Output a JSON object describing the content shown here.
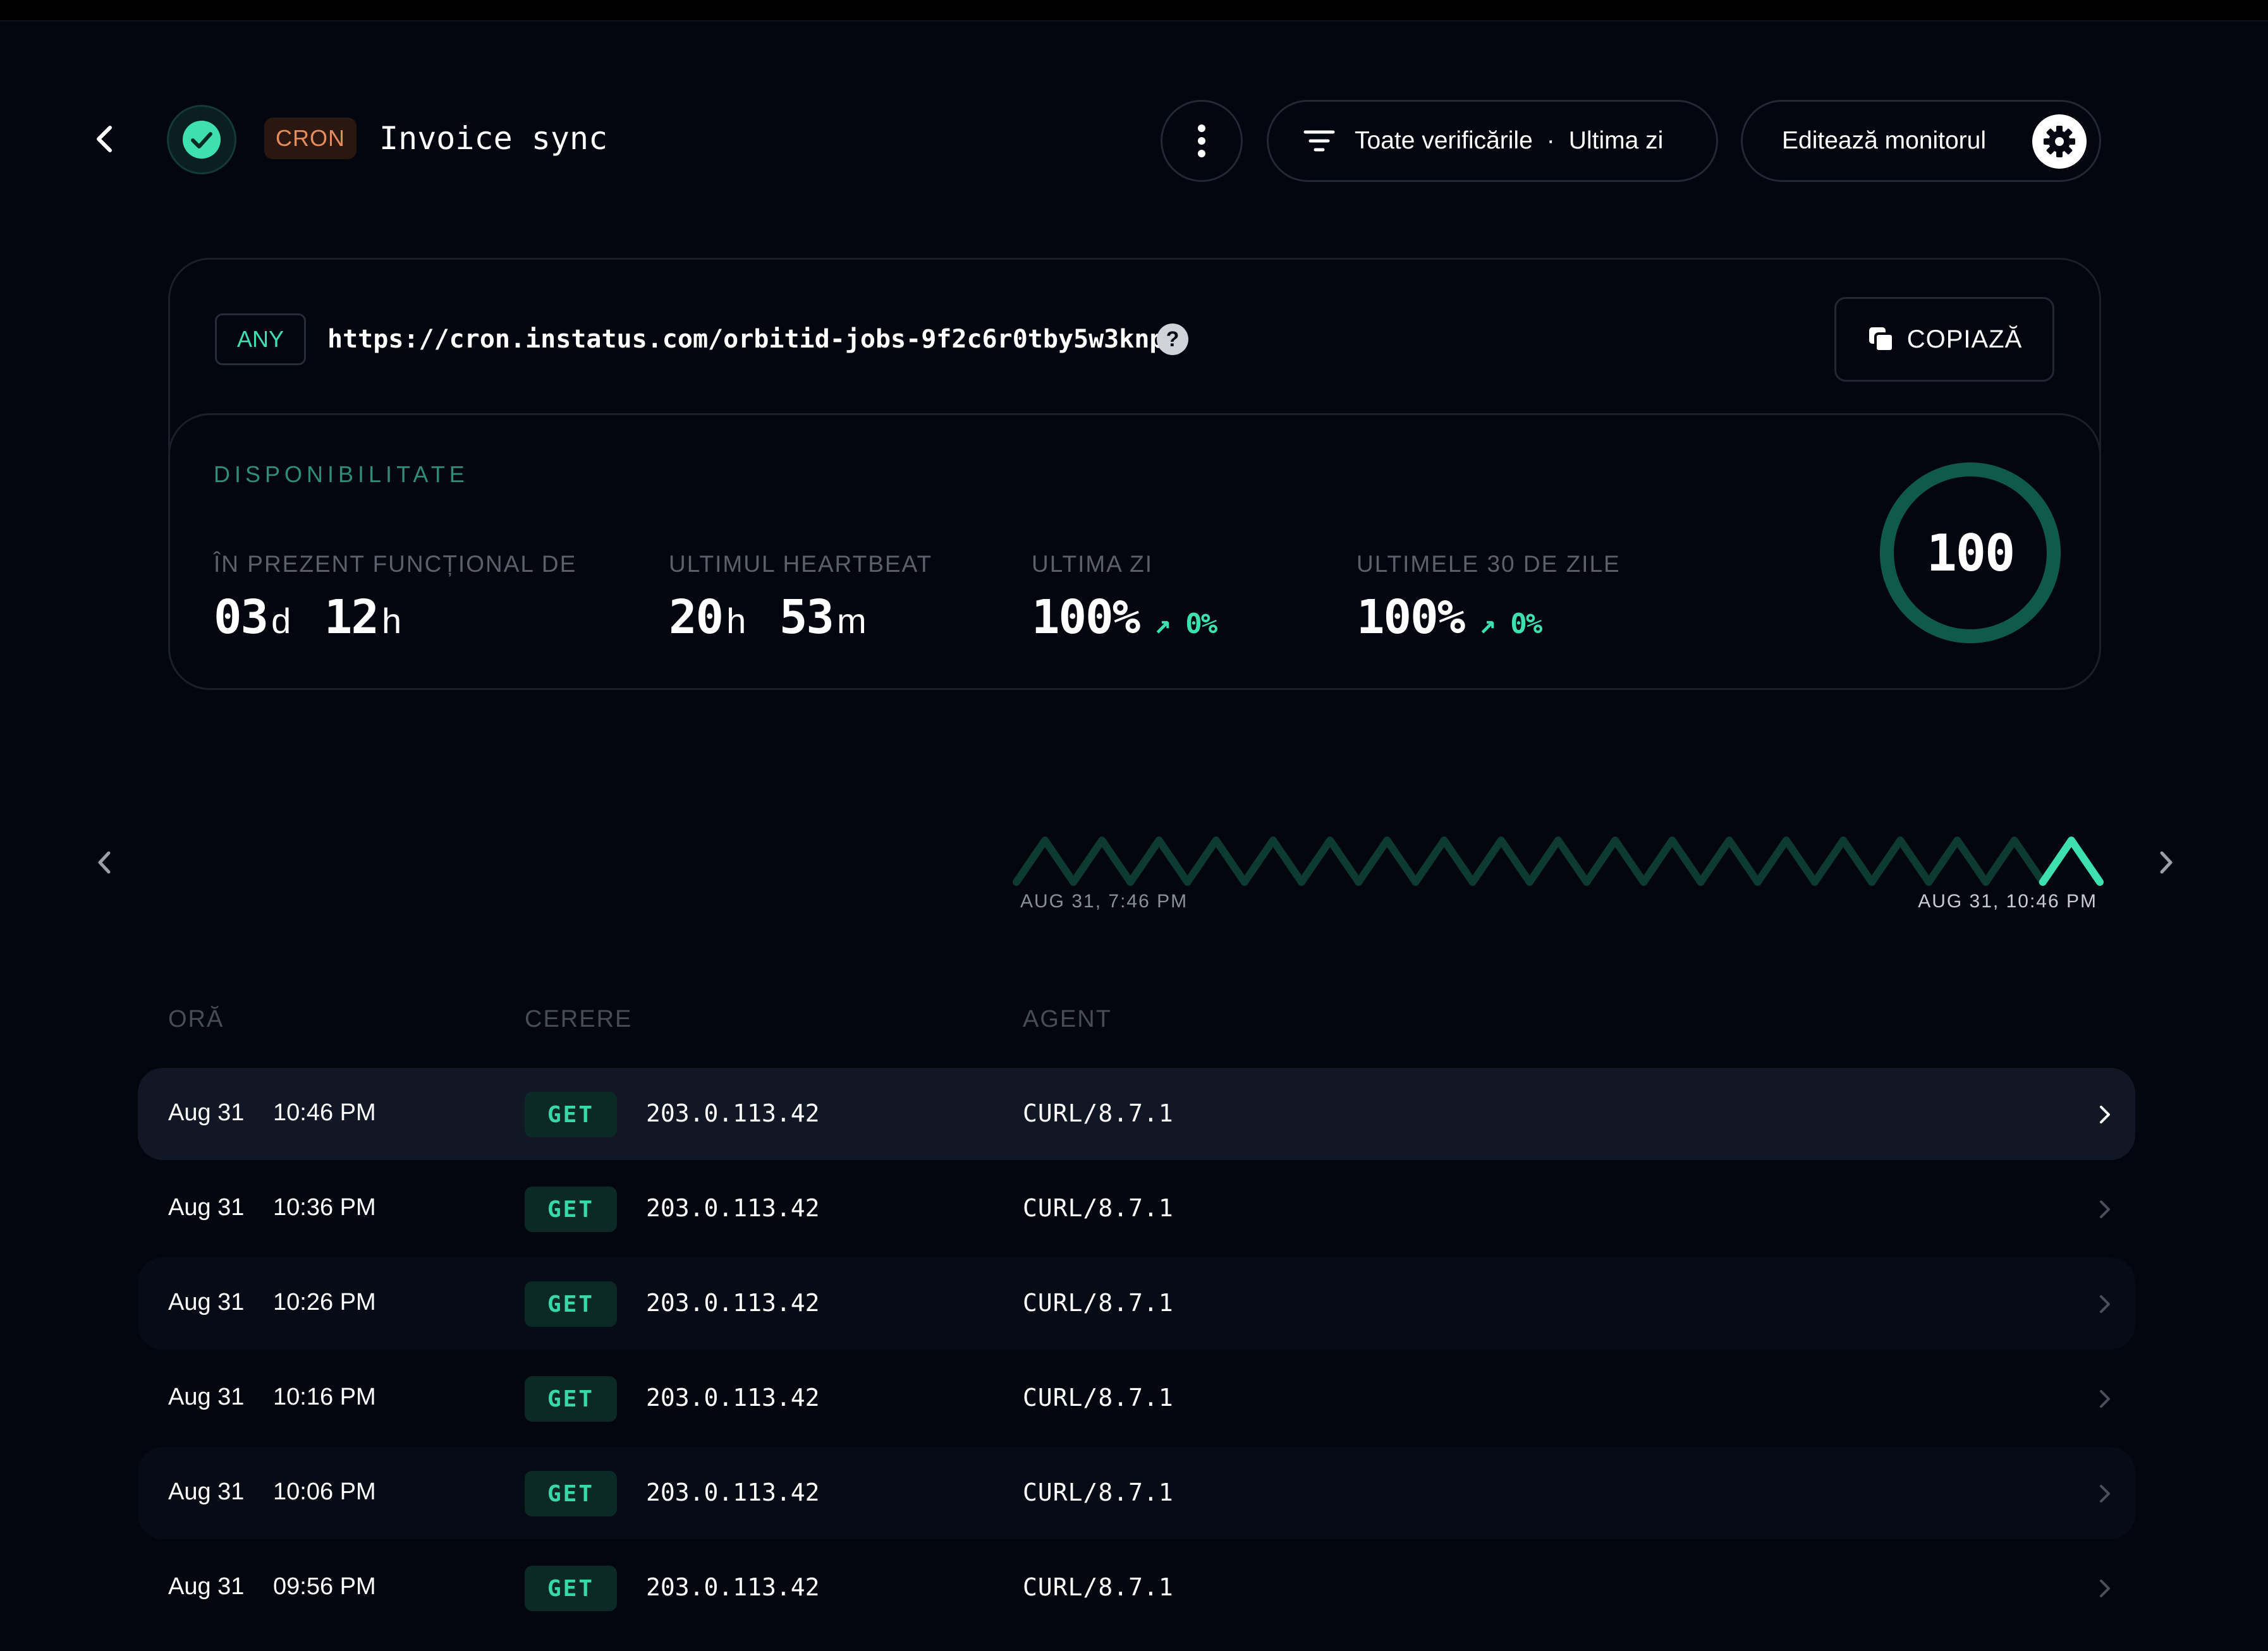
{
  "header": {
    "type_badge": "CRON",
    "title": "Invoice sync",
    "filter_label": "Toate verificările",
    "filter_separator": "·",
    "filter_range": "Ultima zi",
    "edit_label": "Editează monitorul"
  },
  "endpoint": {
    "method_badge": "ANY",
    "url": "https://cron.instatus.com/orbitid-jobs-9f2c6r0tby5w3knp",
    "help_glyph": "?",
    "copy_label": "COPIAZĂ"
  },
  "availability": {
    "section_title": "DISPONIBILITATE",
    "stats": [
      {
        "label": "ÎN PREZENT FUNCȚIONAL DE",
        "v1": "03",
        "u1": "d",
        "v2": "12",
        "u2": "h"
      },
      {
        "label": "ULTIMUL HEARTBEAT",
        "v1": "20",
        "u1": "h",
        "v2": "53",
        "u2": "m"
      },
      {
        "label": "ULTIMA ZI",
        "value": "100%",
        "delta": "↗ 0%"
      },
      {
        "label": "ULTIMELE 30 DE ZILE",
        "value": "100%",
        "delta": "↗ 0%"
      }
    ],
    "score": "100",
    "score_fraction": 1.0
  },
  "timeline": {
    "start_label": "AUG 31, 7:46 PM",
    "end_label": "AUG 31, 10:46 PM",
    "heartbeat_count": 19
  },
  "table": {
    "columns": [
      "ORĂ",
      "CERERE",
      "AGENT"
    ],
    "rows": [
      {
        "date": "Aug 31",
        "time": "10:46 PM",
        "method": "GET",
        "ip": "203.0.113.42",
        "agent": "CURL/8.7.1"
      },
      {
        "date": "Aug 31",
        "time": "10:36 PM",
        "method": "GET",
        "ip": "203.0.113.42",
        "agent": "CURL/8.7.1"
      },
      {
        "date": "Aug 31",
        "time": "10:26 PM",
        "method": "GET",
        "ip": "203.0.113.42",
        "agent": "CURL/8.7.1"
      },
      {
        "date": "Aug 31",
        "time": "10:16 PM",
        "method": "GET",
        "ip": "203.0.113.42",
        "agent": "CURL/8.7.1"
      },
      {
        "date": "Aug 31",
        "time": "10:06 PM",
        "method": "GET",
        "ip": "203.0.113.42",
        "agent": "CURL/8.7.1"
      },
      {
        "date": "Aug 31",
        "time": "09:56 PM",
        "method": "GET",
        "ip": "203.0.113.42",
        "agent": "CURL/8.7.1"
      }
    ]
  },
  "colors": {
    "accent": "#3ee0b0",
    "accent_dim": "#0d3a31",
    "badge_cron_bg": "#2a1710",
    "badge_cron_text": "#e58c5c",
    "background": "#03060f"
  },
  "icons": {
    "back": "chevron-left-icon",
    "status": "check-circle-icon",
    "more": "more-vertical-icon",
    "filter": "filter-lines-icon",
    "settings": "gear-icon",
    "copy": "copy-icon",
    "help": "help-circle-icon",
    "prev": "chevron-left-icon",
    "next": "chevron-right-icon",
    "row_open": "chevron-right-icon"
  }
}
